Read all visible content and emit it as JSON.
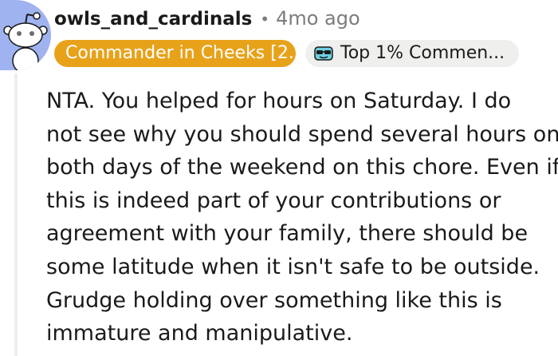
{
  "comment": {
    "author": {
      "username": "owls_and_cardinals",
      "avatar_icon": "snoo-avatar-icon"
    },
    "separator": "•",
    "timestamp": "4mo ago",
    "flairs": {
      "user_flair": "Commander in Cheeks [2...",
      "user_flair_color": "#e8a21a",
      "badge_icon": "sunglasses-badge-icon",
      "top_commenter": "Top 1% Commen..."
    },
    "body_lines": [
      "NTA. You helped for hours on Saturday. I do",
      "not see why you should spend several hours on",
      "both days of the weekend on this chore. Even if",
      "this is indeed part of your contributions or",
      "agreement with your family, there should be",
      "some latitude when it isn't safe to be outside.",
      "Grudge holding over something like this is",
      "immature and manipulative."
    ]
  }
}
